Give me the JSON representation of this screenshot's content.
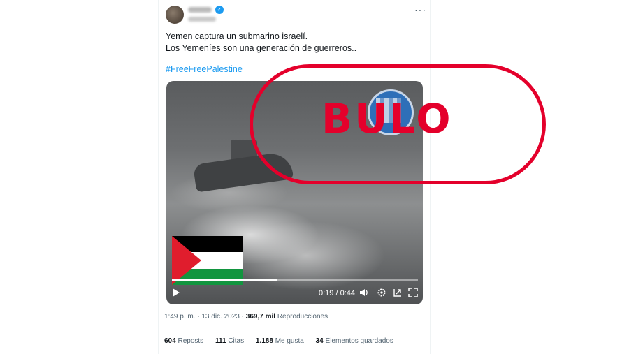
{
  "tweet": {
    "text_line1": "Yemen captura un submarino israelí.",
    "text_line2": "Los Yemeníes son una generación de guerreros..",
    "hashtag": "#FreeFreePalestine"
  },
  "video": {
    "time_display": "0:19 / 0:44",
    "progress": 0.43,
    "play_icon": "play-icon",
    "controls": [
      "volume-icon",
      "settings-icon",
      "skip-icon",
      "fullscreen-icon"
    ]
  },
  "meta": {
    "time": "1:49 p. m.",
    "sep1": "·",
    "date": "13 dic. 2023",
    "sep2": "·",
    "views_count": "369,7 mil",
    "views_label": "Reproducciones"
  },
  "stats": {
    "reposts_count": "604",
    "reposts_label": "Reposts",
    "quotes_count": "111",
    "quotes_label": "Citas",
    "likes_count": "1.188",
    "likes_label": "Me gusta",
    "bookmarks_count": "34",
    "bookmarks_label": "Elementos guardados"
  },
  "stamp": {
    "text": "BULO",
    "color": "#e4002b"
  },
  "colors": {
    "link": "#1d9bf0",
    "muted": "#536471"
  }
}
